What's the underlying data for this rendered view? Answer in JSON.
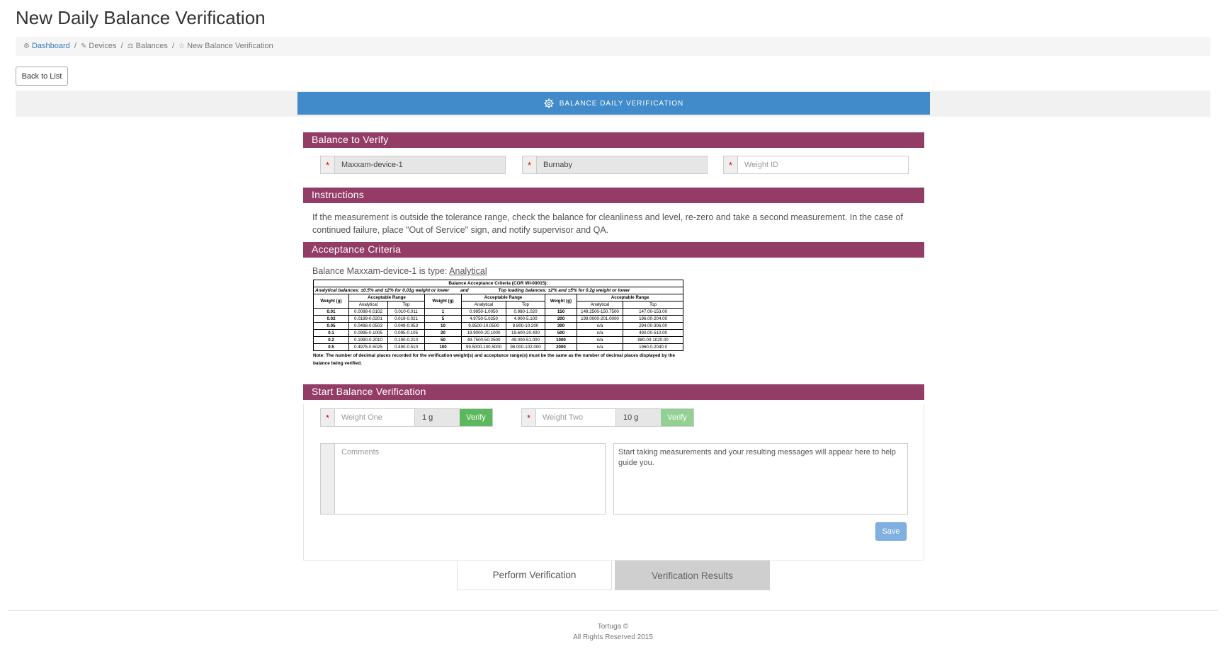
{
  "page": {
    "title": "New Daily Balance Verification"
  },
  "breadcrumb": {
    "dashboard": "Dashboard",
    "devices": "Devices",
    "balances": "Balances",
    "current": "New Balance Verification"
  },
  "back_button": "Back to List",
  "top_tab": {
    "label": "BALANCE DAILY VERIFICATION",
    "icon": "gear-icon"
  },
  "sections": {
    "balance_to_verify": "Balance to Verify",
    "instructions": "Instructions",
    "acceptance_criteria": "Acceptance Criteria",
    "start_verification": "Start Balance Verification"
  },
  "balance_fields": {
    "device": "Maxxam-device-1",
    "location": "Burnaby",
    "weight_id_placeholder": "Weight ID"
  },
  "instructions_text": "If the measurement is outside the tolerance range, check the balance for cleanliness and level, re-zero and take a second measurement. In the case of continued failure, place \"Out of Service\" sign, and notify supervisor and QA.",
  "acceptance": {
    "prefix": "Balance Maxxam-device-1 is type:",
    "type_link": "Analytical",
    "table": {
      "caption": "Balance Acceptance Criteria (COR WI-00015):",
      "subcaption_left": "Analytical balances:  ±0.5% and ±2% for 0.01g weight or lower",
      "subcaption_mid": "and",
      "subcaption_right": "Top loading balances: ±2% and ±5% for 0.2g weight or lower",
      "h_weight": "Weight (g)",
      "h_range": "Acceptable  Range",
      "h_analytical": "Analytical",
      "h_top": "Top",
      "rows": [
        [
          "0.01",
          "0.0098-0.0102",
          "0.010-0.011",
          "1",
          "0.9950-1.0050",
          "0.980-1.020",
          "150",
          "149.2500-150.7500",
          "147.00-153.00"
        ],
        [
          "0.02",
          "0.0199-0.0201",
          "0.019-0.021",
          "5",
          "4.9750-5.0250",
          "4.900-5.100",
          "200",
          "199.0000-201.0000",
          "196.00-204.00"
        ],
        [
          "0.05",
          "0.0498-0.0503",
          "0.049-0.053",
          "10",
          "9.9500-10.0500",
          "9.800-10.200",
          "300",
          "n/a",
          "294.00-306.00"
        ],
        [
          "0.1",
          "0.0995-0.1005",
          "0.095-0.105",
          "20",
          "19.9000-20.1000",
          "19.600-20.400",
          "500",
          "n/a",
          "490.00-510.00"
        ],
        [
          "0.2",
          "0.1990-0.2010",
          "0.190-0.210",
          "50",
          "49.7500-50.2500",
          "49.000-51.000",
          "1000",
          "n/a",
          "980.00-1020.00"
        ],
        [
          "0.5",
          "0.4975-0.5025",
          "0.490-0.510",
          "100",
          "99.5000-100.5000",
          "98.000-102.000",
          "2000",
          "n/a",
          "1960.0-2040.0"
        ]
      ],
      "note": "Note: The number of decimal places recorded for the verification weight(s) and acceptance range(s) must be the same as the number of decimal places displayed by the balance being verified."
    }
  },
  "verification": {
    "weight_one_placeholder": "Weight One",
    "weight_one_unit": "1 g",
    "weight_two_placeholder": "Weight Two",
    "weight_two_unit": "10 g",
    "verify_label": "Verify",
    "comments_placeholder": "Comments",
    "messages": "Start taking measurements and your resulting messages will appear here to help guide you.",
    "save_label": "Save"
  },
  "bottom_tabs": {
    "perform": "Perform Verification",
    "results": "Verification Results"
  },
  "footer": {
    "line1": "Tortuga ©",
    "line2": "All Rights Reserved 2015"
  },
  "colors": {
    "accent_blue": "#428bca",
    "section_bar": "#933c66",
    "verify_green": "#5cb85c",
    "save_blue": "#7fb0df"
  }
}
